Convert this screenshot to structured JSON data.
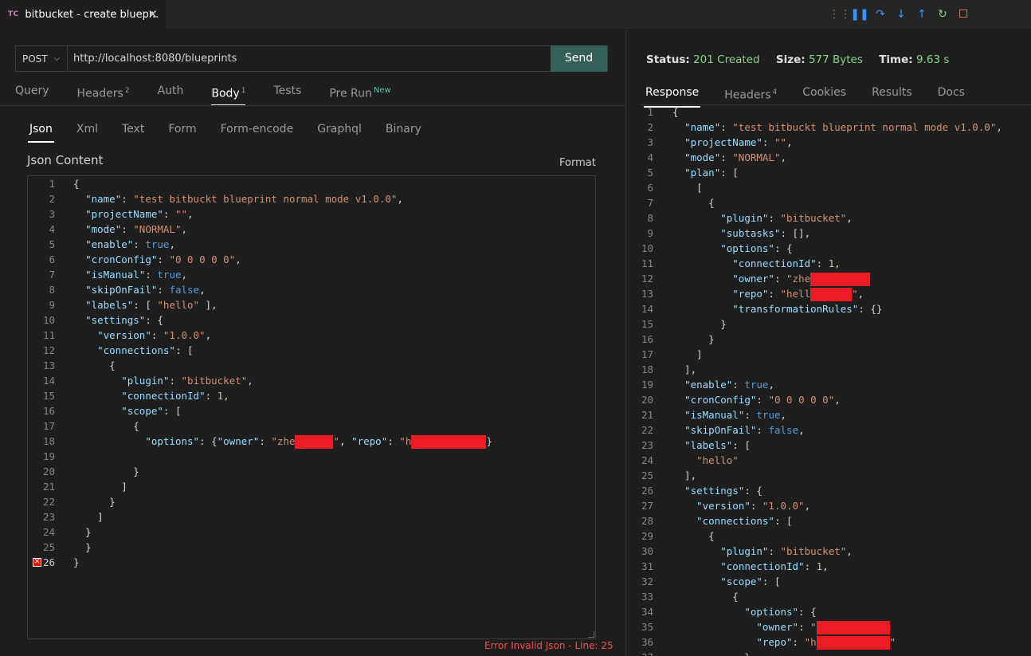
{
  "tab": {
    "badge": "TC",
    "title": "bitbucket - create bluepr..",
    "close": "✕"
  },
  "debug_toolbar": [
    "grip-icon",
    "pause-icon",
    "step-over-icon",
    "step-into-icon",
    "step-out-icon",
    "restart-icon",
    "stop-icon"
  ],
  "request": {
    "method": "POST",
    "url": "http://localhost:8080/blueprints",
    "send_label": "Send"
  },
  "request_tabs": [
    {
      "label": "Query",
      "sup": ""
    },
    {
      "label": "Headers",
      "sup": "2"
    },
    {
      "label": "Auth",
      "sup": ""
    },
    {
      "label": "Body",
      "sup": "1"
    },
    {
      "label": "Tests",
      "sup": ""
    },
    {
      "label": "Pre Run",
      "sup": "New"
    }
  ],
  "active_request_tab": "Body",
  "body_tabs": [
    "Json",
    "Xml",
    "Text",
    "Form",
    "Form-encode",
    "Graphql",
    "Binary"
  ],
  "active_body_tab": "Json",
  "json_content_label": "Json Content",
  "format_label": "Format",
  "error_text": "Error Invalid Json - Line: 25",
  "request_body_lines": [
    [
      [
        "p",
        "{"
      ]
    ],
    [
      [
        "p",
        "  "
      ],
      [
        "k",
        "\"name\""
      ],
      [
        "p",
        ": "
      ],
      [
        "s",
        "\"test bitbuckt blueprint normal mode v1.0.0\""
      ],
      [
        "p",
        ","
      ]
    ],
    [
      [
        "p",
        "  "
      ],
      [
        "k",
        "\"projectName\""
      ],
      [
        "p",
        ": "
      ],
      [
        "s",
        "\"\""
      ],
      [
        "p",
        ","
      ]
    ],
    [
      [
        "p",
        "  "
      ],
      [
        "k",
        "\"mode\""
      ],
      [
        "p",
        ": "
      ],
      [
        "s",
        "\"NORMAL\""
      ],
      [
        "p",
        ","
      ]
    ],
    [
      [
        "p",
        "  "
      ],
      [
        "k",
        "\"enable\""
      ],
      [
        "p",
        ": "
      ],
      [
        "b",
        "true"
      ],
      [
        "p",
        ","
      ]
    ],
    [
      [
        "p",
        "  "
      ],
      [
        "k",
        "\"cronConfig\""
      ],
      [
        "p",
        ": "
      ],
      [
        "s",
        "\"0 0 0 0 0\""
      ],
      [
        "p",
        ","
      ]
    ],
    [
      [
        "p",
        "  "
      ],
      [
        "k",
        "\"isManual\""
      ],
      [
        "p",
        ": "
      ],
      [
        "b",
        "true"
      ],
      [
        "p",
        ","
      ]
    ],
    [
      [
        "p",
        "  "
      ],
      [
        "k",
        "\"skipOnFail\""
      ],
      [
        "p",
        ": "
      ],
      [
        "b",
        "false"
      ],
      [
        "p",
        ","
      ]
    ],
    [
      [
        "p",
        "  "
      ],
      [
        "k",
        "\"labels\""
      ],
      [
        "p",
        ": [ "
      ],
      [
        "s",
        "\"hello\""
      ],
      [
        "p",
        " ],"
      ]
    ],
    [
      [
        "p",
        "  "
      ],
      [
        "k",
        "\"settings\""
      ],
      [
        "p",
        ": {"
      ]
    ],
    [
      [
        "p",
        "    "
      ],
      [
        "k",
        "\"version\""
      ],
      [
        "p",
        ": "
      ],
      [
        "s",
        "\"1.0.0\""
      ],
      [
        "p",
        ","
      ]
    ],
    [
      [
        "p",
        "    "
      ],
      [
        "k",
        "\"connections\""
      ],
      [
        "p",
        ": ["
      ]
    ],
    [
      [
        "p",
        "      {"
      ]
    ],
    [
      [
        "p",
        "        "
      ],
      [
        "k",
        "\"plugin\""
      ],
      [
        "p",
        ": "
      ],
      [
        "s",
        "\"bitbucket\""
      ],
      [
        "p",
        ","
      ]
    ],
    [
      [
        "p",
        "        "
      ],
      [
        "k",
        "\"connectionId\""
      ],
      [
        "p",
        ": "
      ],
      [
        "n",
        "1"
      ],
      [
        "p",
        ","
      ]
    ],
    [
      [
        "p",
        "        "
      ],
      [
        "k",
        "\"scope\""
      ],
      [
        "p",
        ": ["
      ]
    ],
    [
      [
        "p",
        "          {"
      ]
    ],
    [
      [
        "p",
        "            "
      ],
      [
        "k",
        "\"options\""
      ],
      [
        "p",
        ": {"
      ],
      [
        "k",
        "\"owner\""
      ],
      [
        "p",
        ": "
      ],
      [
        "s",
        "\"zhe"
      ],
      [
        "r",
        "48"
      ],
      [
        "s",
        "\""
      ],
      [
        "p",
        ", "
      ],
      [
        "k",
        "\"repo\""
      ],
      [
        "p",
        ": "
      ],
      [
        "s",
        "\"h"
      ],
      [
        "r",
        "94"
      ],
      [
        "p",
        "}"
      ]
    ],
    [
      [
        "p",
        ""
      ]
    ],
    [
      [
        "p",
        "          }"
      ]
    ],
    [
      [
        "p",
        "        ]"
      ]
    ],
    [
      [
        "p",
        "      }"
      ]
    ],
    [
      [
        "p",
        "    ]"
      ]
    ],
    [
      [
        "p",
        "  }"
      ]
    ],
    [
      [
        "p",
        "  }"
      ]
    ],
    [
      [
        "p",
        "}"
      ]
    ]
  ],
  "error_line": 26,
  "response": {
    "status_label": "Status:",
    "status_value": "201 Created",
    "size_label": "Size:",
    "size_value": "577 Bytes",
    "time_label": "Time:",
    "time_value": "9.63 s"
  },
  "response_tabs": [
    {
      "label": "Response",
      "sup": ""
    },
    {
      "label": "Headers",
      "sup": "4"
    },
    {
      "label": "Cookies",
      "sup": ""
    },
    {
      "label": "Results",
      "sup": ""
    },
    {
      "label": "Docs",
      "sup": ""
    }
  ],
  "active_response_tab": "Response",
  "response_body_lines": [
    [
      [
        "p",
        "{"
      ]
    ],
    [
      [
        "p",
        "  "
      ],
      [
        "k",
        "\"name\""
      ],
      [
        "p",
        ": "
      ],
      [
        "s",
        "\"test bitbuckt blueprint normal mode v1.0.0\""
      ],
      [
        "p",
        ","
      ]
    ],
    [
      [
        "p",
        "  "
      ],
      [
        "k",
        "\"projectName\""
      ],
      [
        "p",
        ": "
      ],
      [
        "s",
        "\"\""
      ],
      [
        "p",
        ","
      ]
    ],
    [
      [
        "p",
        "  "
      ],
      [
        "k",
        "\"mode\""
      ],
      [
        "p",
        ": "
      ],
      [
        "s",
        "\"NORMAL\""
      ],
      [
        "p",
        ","
      ]
    ],
    [
      [
        "p",
        "  "
      ],
      [
        "k",
        "\"plan\""
      ],
      [
        "p",
        ": ["
      ]
    ],
    [
      [
        "p",
        "    ["
      ]
    ],
    [
      [
        "p",
        "      {"
      ]
    ],
    [
      [
        "p",
        "        "
      ],
      [
        "k",
        "\"plugin\""
      ],
      [
        "p",
        ": "
      ],
      [
        "s",
        "\"bitbucket\""
      ],
      [
        "p",
        ","
      ]
    ],
    [
      [
        "p",
        "        "
      ],
      [
        "k",
        "\"subtasks\""
      ],
      [
        "p",
        ": [],"
      ]
    ],
    [
      [
        "p",
        "        "
      ],
      [
        "k",
        "\"options\""
      ],
      [
        "p",
        ": {"
      ]
    ],
    [
      [
        "p",
        "          "
      ],
      [
        "k",
        "\"connectionId\""
      ],
      [
        "p",
        ": "
      ],
      [
        "n",
        "1"
      ],
      [
        "p",
        ","
      ]
    ],
    [
      [
        "p",
        "          "
      ],
      [
        "k",
        "\"owner\""
      ],
      [
        "p",
        ": "
      ],
      [
        "s",
        "\"zhe"
      ],
      [
        "r",
        "75"
      ]
    ],
    [
      [
        "p",
        "          "
      ],
      [
        "k",
        "\"repo\""
      ],
      [
        "p",
        ": "
      ],
      [
        "s",
        "\"hell"
      ],
      [
        "r",
        "52"
      ],
      [
        "s",
        "\""
      ],
      [
        "p",
        ","
      ]
    ],
    [
      [
        "p",
        "          "
      ],
      [
        "k",
        "\"transformationRules\""
      ],
      [
        "p",
        ": {}"
      ]
    ],
    [
      [
        "p",
        "        }"
      ]
    ],
    [
      [
        "p",
        "      }"
      ]
    ],
    [
      [
        "p",
        "    ]"
      ]
    ],
    [
      [
        "p",
        "  ],"
      ]
    ],
    [
      [
        "p",
        "  "
      ],
      [
        "k",
        "\"enable\""
      ],
      [
        "p",
        ": "
      ],
      [
        "b",
        "true"
      ],
      [
        "p",
        ","
      ]
    ],
    [
      [
        "p",
        "  "
      ],
      [
        "k",
        "\"cronConfig\""
      ],
      [
        "p",
        ": "
      ],
      [
        "s",
        "\"0 0 0 0 0\""
      ],
      [
        "p",
        ","
      ]
    ],
    [
      [
        "p",
        "  "
      ],
      [
        "k",
        "\"isManual\""
      ],
      [
        "p",
        ": "
      ],
      [
        "b",
        "true"
      ],
      [
        "p",
        ","
      ]
    ],
    [
      [
        "p",
        "  "
      ],
      [
        "k",
        "\"skipOnFail\""
      ],
      [
        "p",
        ": "
      ],
      [
        "b",
        "false"
      ],
      [
        "p",
        ","
      ]
    ],
    [
      [
        "p",
        "  "
      ],
      [
        "k",
        "\"labels\""
      ],
      [
        "p",
        ": ["
      ]
    ],
    [
      [
        "p",
        "    "
      ],
      [
        "s",
        "\"hello\""
      ]
    ],
    [
      [
        "p",
        "  ],"
      ]
    ],
    [
      [
        "p",
        "  "
      ],
      [
        "k",
        "\"settings\""
      ],
      [
        "p",
        ": {"
      ]
    ],
    [
      [
        "p",
        "    "
      ],
      [
        "k",
        "\"version\""
      ],
      [
        "p",
        ": "
      ],
      [
        "s",
        "\"1.0.0\""
      ],
      [
        "p",
        ","
      ]
    ],
    [
      [
        "p",
        "    "
      ],
      [
        "k",
        "\"connections\""
      ],
      [
        "p",
        ": ["
      ]
    ],
    [
      [
        "p",
        "      {"
      ]
    ],
    [
      [
        "p",
        "        "
      ],
      [
        "k",
        "\"plugin\""
      ],
      [
        "p",
        ": "
      ],
      [
        "s",
        "\"bitbucket\""
      ],
      [
        "p",
        ","
      ]
    ],
    [
      [
        "p",
        "        "
      ],
      [
        "k",
        "\"connectionId\""
      ],
      [
        "p",
        ": "
      ],
      [
        "n",
        "1"
      ],
      [
        "p",
        ","
      ]
    ],
    [
      [
        "p",
        "        "
      ],
      [
        "k",
        "\"scope\""
      ],
      [
        "p",
        ": ["
      ]
    ],
    [
      [
        "p",
        "          {"
      ]
    ],
    [
      [
        "p",
        "            "
      ],
      [
        "k",
        "\"options\""
      ],
      [
        "p",
        ": {"
      ]
    ],
    [
      [
        "p",
        "              "
      ],
      [
        "k",
        "\"owner\""
      ],
      [
        "p",
        ": "
      ],
      [
        "s",
        "\""
      ],
      [
        "r",
        "92"
      ]
    ],
    [
      [
        "p",
        "              "
      ],
      [
        "k",
        "\"repo\""
      ],
      [
        "p",
        ": "
      ],
      [
        "s",
        "\"h"
      ],
      [
        "r",
        "92"
      ],
      [
        "s",
        "\""
      ]
    ],
    [
      [
        "p",
        "            }"
      ]
    ]
  ]
}
